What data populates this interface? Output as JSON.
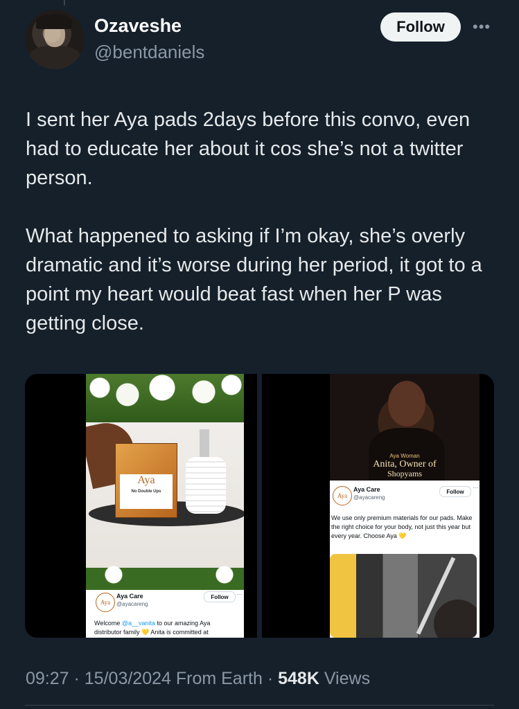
{
  "author": {
    "display_name": "Ozaveshe",
    "handle": "@bentdaniels",
    "follow_label": "Follow",
    "more_label": "•••"
  },
  "tweet": {
    "paragraphs": [
      "I sent her Aya pads 2days before this convo, even had to educate her about it cos she’s not a twitter person.",
      "What happened to asking if I’m okay, she’s overly dramatic and it’s worse during her period, it got to a point my heart would beat fast when her P was getting close."
    ]
  },
  "media": {
    "left": {
      "box_brand": "Aya",
      "box_subtitle": "No Double Ups",
      "card": {
        "avatar_label": "Aya",
        "name": "Aya Care",
        "handle": "@ayacareng",
        "follow_label": "Follow",
        "more_label": "···",
        "text_pre": "Welcome ",
        "mention": "@a__vanita",
        "text_post": " to our amazing Aya distributor family ",
        "heart": "💛",
        "text_end": " Anita is committed at"
      }
    },
    "right": {
      "overline": "Aya Woman",
      "title": "Anita, Owner of",
      "title_line2": "Shopyams",
      "card": {
        "avatar_label": "Aya",
        "name": "Aya Care",
        "handle": "@ayacareng",
        "follow_label": "Follow",
        "more_label": "···",
        "text": "We use only premium materials for our pads. Make the right choice for your body, not just this year but every year. Choose Aya ",
        "heart": "💛"
      }
    }
  },
  "meta": {
    "time": "09:27",
    "date": "15/03/2024",
    "source": "From Earth",
    "views_count": "548K",
    "views_label": "Views",
    "separator": " · "
  },
  "colors": {
    "background": "#15202b",
    "secondary_text": "#8b98a5",
    "primary_text": "#e7e9ea",
    "follow_button_bg": "#eff3f4"
  }
}
